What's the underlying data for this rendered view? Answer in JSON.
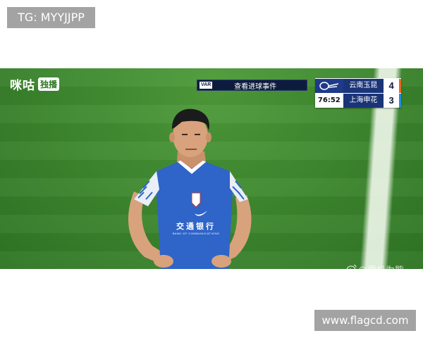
{
  "overlay": {
    "top_left_tag": "TG: MYYJJPP",
    "bottom_right_tag": "www.flagcd.com"
  },
  "broadcast": {
    "brand_name": "咪咕",
    "brand_badge": "独播",
    "var_badge": "VAR",
    "var_text": "查看进球事件",
    "scoreboard": {
      "home_team": "云南玉昆",
      "home_score": "4",
      "away_team": "上海申花",
      "away_score": "3",
      "match_time": "76:52"
    },
    "watermark": "@零机为熊"
  },
  "jersey": {
    "sponsor_text": "交通银行",
    "sponsor_sub": "BANK OF COMMUNICATIONS"
  },
  "colors": {
    "pitch_green": "#3f8a30",
    "jersey_blue": "#2f64c8",
    "scoreboard_navy": "#1a3478",
    "home_accent": "#e8691b",
    "away_accent": "#1e90d4"
  }
}
